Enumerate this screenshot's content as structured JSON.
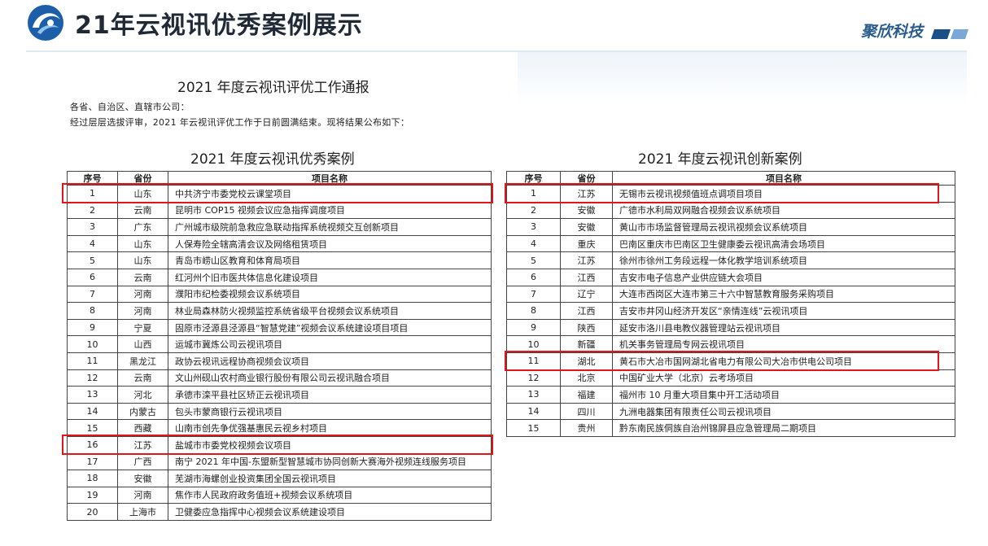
{
  "header": {
    "title": "21年云视讯优秀案例展示",
    "brand": "聚欣科技"
  },
  "document": {
    "title": "2021 年度云视讯评优工作通报",
    "salutation": "各省、自治区、直辖市公司：",
    "body": "经过层层选拔评审，2021 年云视讯评优工作于日前圆满结束。现将结果公布如下："
  },
  "excellent": {
    "title": "2021 年度云视讯优秀案例",
    "headers": [
      "序号",
      "省份",
      "项目名称"
    ],
    "rows": [
      {
        "no": "1",
        "province": "山东",
        "name": "中共济宁市委党校云课堂项目",
        "highlight": true
      },
      {
        "no": "2",
        "province": "云南",
        "name": "昆明市 COP15 视频会议应急指挥调度项目"
      },
      {
        "no": "3",
        "province": "广东",
        "name": "广州城市级院前急救应急联动指挥系统视频交互创新项目"
      },
      {
        "no": "4",
        "province": "山东",
        "name": "人保寿险全辖高清会议及网络租赁项目"
      },
      {
        "no": "5",
        "province": "山东",
        "name": "青岛市崂山区教育和体育局项目"
      },
      {
        "no": "6",
        "province": "云南",
        "name": "红河州个旧市医共体信息化建设项目"
      },
      {
        "no": "7",
        "province": "河南",
        "name": "濮阳市纪检委视频会议系统项目"
      },
      {
        "no": "8",
        "province": "河南",
        "name": "林业局森林防火视频监控系统省级平台视频会议系统项目"
      },
      {
        "no": "9",
        "province": "宁夏",
        "name": "固原市泾源县泾源县“智慧党建”视频会议系统建设项目项目"
      },
      {
        "no": "10",
        "province": "山西",
        "name": "运城市冀炼公司云视讯项目"
      },
      {
        "no": "11",
        "province": "黑龙江",
        "name": "政协云视讯远程协商视频会议项目"
      },
      {
        "no": "12",
        "province": "云南",
        "name": "文山州砚山农村商业银行股份有限公司云视讯融合项目"
      },
      {
        "no": "13",
        "province": "河北",
        "name": "承德市滦平县社区矫正云视讯项目"
      },
      {
        "no": "14",
        "province": "内蒙古",
        "name": "包头市蒙商银行云视讯项目"
      },
      {
        "no": "15",
        "province": "西藏",
        "name": "山南市创先争优强基惠民云视乡村项目"
      },
      {
        "no": "16",
        "province": "江苏",
        "name": "盐城市市委党校视频会议项目",
        "highlight": true
      },
      {
        "no": "17",
        "province": "广西",
        "name": "南宁 2021 年中国-东盟新型智慧城市协同创新大赛海外视频连线服务项目"
      },
      {
        "no": "18",
        "province": "安徽",
        "name": "芜湖市海螺创业投资集团全国云视讯项目"
      },
      {
        "no": "19",
        "province": "河南",
        "name": "焦作市人民政府政务值班+视频会议系统项目"
      },
      {
        "no": "20",
        "province": "上海市",
        "name": "卫健委应急指挥中心视频会议系统建设项目"
      }
    ]
  },
  "innovation": {
    "title": "2021 年度云视讯创新案例",
    "headers": [
      "序号",
      "省份",
      "项目名称"
    ],
    "rows": [
      {
        "no": "1",
        "province": "江苏",
        "name": "无锡市云视讯视频值班点调项目项目",
        "highlight": true
      },
      {
        "no": "2",
        "province": "安徽",
        "name": "广德市水利局双网融合视频会议系统项目"
      },
      {
        "no": "3",
        "province": "安徽",
        "name": "黄山市市场监督管理局云视讯视频会议系统项目"
      },
      {
        "no": "4",
        "province": "重庆",
        "name": "巴南区重庆市巴南区卫生健康委云视讯高清会场项目"
      },
      {
        "no": "5",
        "province": "江苏",
        "name": "徐州市徐州工务段远程一体化教学培训系统项目"
      },
      {
        "no": "6",
        "province": "江西",
        "name": "吉安市电子信息产业供应链大会项目"
      },
      {
        "no": "7",
        "province": "辽宁",
        "name": "大连市西岗区大连市第三十六中智慧教育服务采购项目"
      },
      {
        "no": "8",
        "province": "江西",
        "name": "吉安市井冈山经济开发区“亲情连线”云视讯项目"
      },
      {
        "no": "9",
        "province": "陕西",
        "name": "延安市洛川县电教仪器管理站云视讯项目"
      },
      {
        "no": "10",
        "province": "新疆",
        "name": "机关事务管理局专网云视讯项目"
      },
      {
        "no": "11",
        "province": "湖北",
        "name": "黄石市大冶市国网湖北省电力有限公司大冶市供电公司项目",
        "highlight": true
      },
      {
        "no": "12",
        "province": "北京",
        "name": "中国矿业大学（北京）云考场项目"
      },
      {
        "no": "13",
        "province": "福建",
        "name": "福州市 10 月重大项目集中开工活动项目"
      },
      {
        "no": "14",
        "province": "四川",
        "name": "九洲电器集团有限责任公司云视讯项目"
      },
      {
        "no": "15",
        "province": "贵州",
        "name": "黔东南民族侗族自治州锦屏县应急管理局二期项目"
      }
    ]
  },
  "colors": {
    "title": "#1f2a36",
    "brand": "#2a5b8e",
    "highlight": "#e0161b",
    "logo_blue": "#1c5fa8"
  },
  "icons": {
    "logo": "blue-swirl-logo-icon",
    "brand_bars": "brand-stripes-icon"
  }
}
